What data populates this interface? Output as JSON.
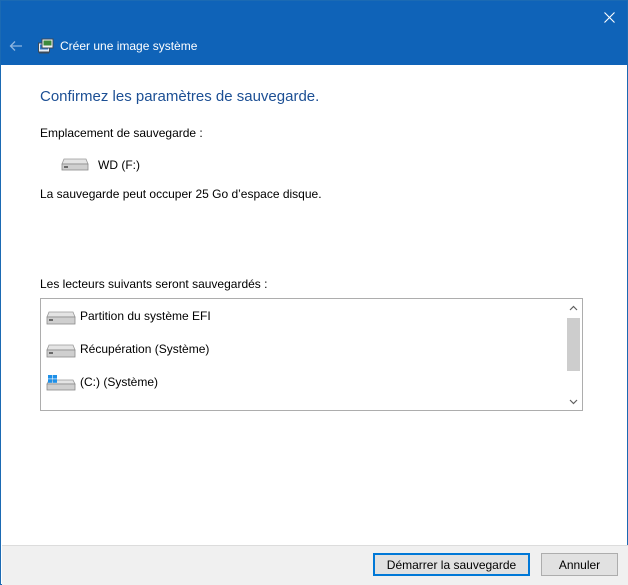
{
  "window": {
    "title": "Créer une image système",
    "accent_color": "#0f63b8"
  },
  "heading": "Confirmez les paramètres de sauvegarde.",
  "backup_location": {
    "label": "Emplacement de sauvegarde :",
    "drive_name": "WD (F:)",
    "drive_icon": "hard-drive-icon"
  },
  "space_notice": "La sauvegarde peut occuper 25 Go d’espace disque.",
  "drives_list": {
    "label": "Les lecteurs suivants seront sauvegardés :",
    "items": [
      {
        "label": "Partition du système EFI",
        "icon": "hard-drive-icon"
      },
      {
        "label": "Récupération (Système)",
        "icon": "hard-drive-icon"
      },
      {
        "label": "(C:) (Système)",
        "icon": "windows-drive-icon"
      }
    ]
  },
  "buttons": {
    "start": "Démarrer la sauvegarde",
    "cancel": "Annuler"
  }
}
